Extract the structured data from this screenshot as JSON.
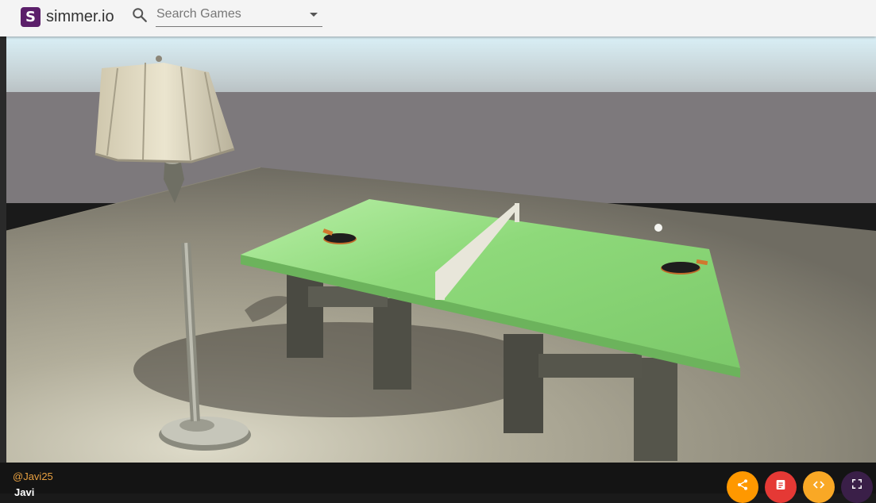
{
  "header": {
    "logo_letter": "S",
    "brand": "simmer.io",
    "search": {
      "placeholder": "Search Games",
      "value": ""
    },
    "icons": {
      "logo": "simmer-logo-icon",
      "search": "search-icon",
      "dropdown": "chevron-down-icon"
    }
  },
  "game": {
    "scene": "3D ping pong table with floor lamp",
    "colors": {
      "table": "#8ed97a",
      "floor": "#8c8878",
      "sky": "#d8ecf3"
    }
  },
  "footer": {
    "handle": "@Javi25",
    "author": "Javi",
    "actions": [
      {
        "icon": "share-icon",
        "color": "#ff9800"
      },
      {
        "icon": "description-icon",
        "color": "#e53935"
      },
      {
        "icon": "code-icon",
        "color": "#f9a825"
      },
      {
        "icon": "fullscreen-icon",
        "color": "#3a1f48"
      }
    ]
  }
}
